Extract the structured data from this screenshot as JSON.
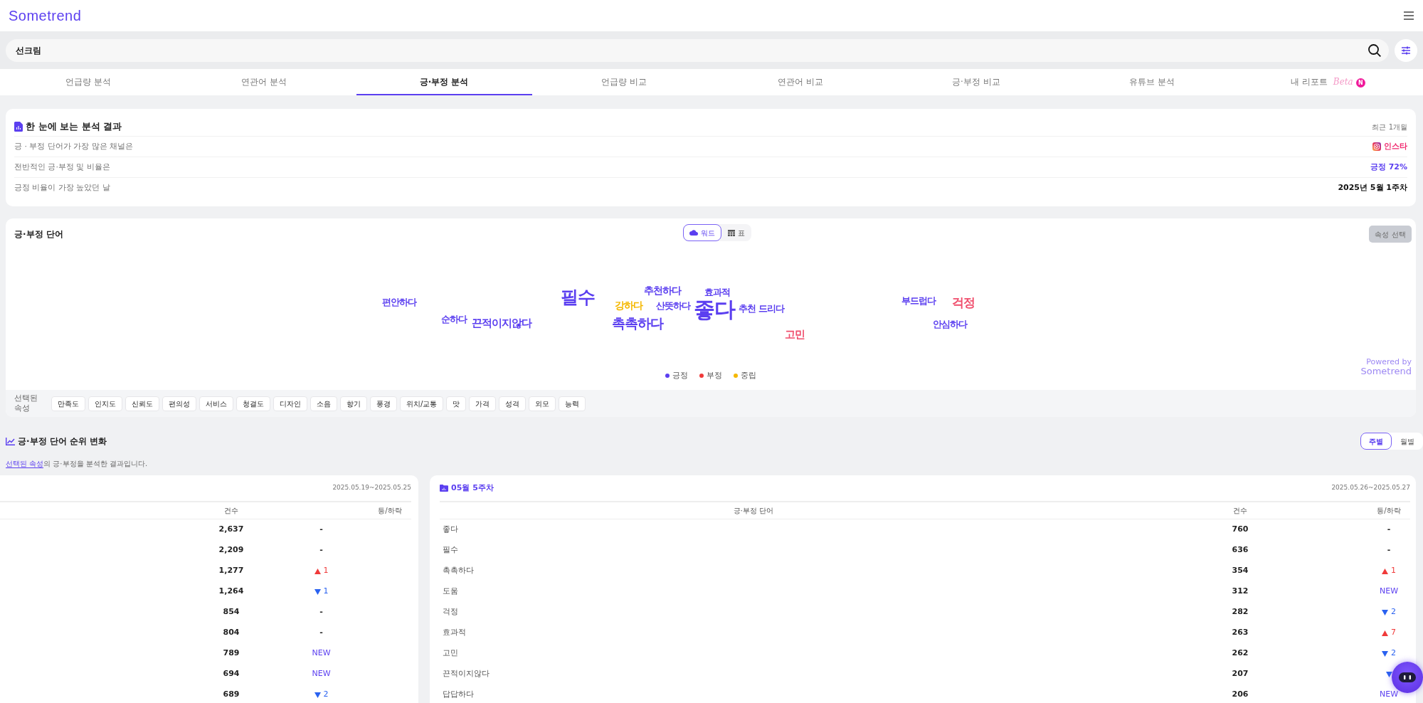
{
  "header": {
    "logo": "Sometrend"
  },
  "search": {
    "value": "선크림"
  },
  "tabs": [
    {
      "label": "언급량 분석",
      "selected": false
    },
    {
      "label": "연관어 분석",
      "selected": false
    },
    {
      "label": "긍·부정 분석",
      "selected": true
    },
    {
      "label": "언급량 비교",
      "selected": false
    },
    {
      "label": "연관어 비교",
      "selected": false
    },
    {
      "label": "긍·부정 비교",
      "selected": false
    },
    {
      "label": "유튜브 분석",
      "selected": false
    },
    {
      "label": "내 리포트",
      "selected": false,
      "beta": "Beta",
      "badge": "N"
    }
  ],
  "summary": {
    "title": "한 눈에 보는 분석 결과",
    "period": "최근 1개월",
    "rows": [
      {
        "label": "긍 · 부정 단어가 가장 많은 채널은",
        "value": "인스타",
        "kind": "channel"
      },
      {
        "label": "전반적인 긍·부정 및 비율은",
        "value": "긍정 72%",
        "kind": "ratio"
      },
      {
        "label": "긍정 비율이 가장 높았던 날",
        "value": "2025년 5월 1주차",
        "kind": "date"
      }
    ]
  },
  "word_panel": {
    "title": "긍·부정 단어",
    "views": [
      {
        "label": "워드",
        "kind": "cloud",
        "selected": true
      },
      {
        "label": "표",
        "kind": "table",
        "selected": false
      }
    ],
    "attribute_button": "속성 선택",
    "words": [
      {
        "text": "편안하다",
        "color": "#5b3ff0"
      },
      {
        "text": "순하다",
        "color": "#5b3ff0"
      },
      {
        "text": "끈적이지않다",
        "color": "#5b3ff0"
      },
      {
        "text": "필수",
        "color": "#5b3ff0"
      },
      {
        "text": "강하다",
        "color": "#f5b800"
      },
      {
        "text": "추천하다",
        "color": "#5b3ff0"
      },
      {
        "text": "산뜻하다",
        "color": "#5b3ff0"
      },
      {
        "text": "촉촉하다",
        "color": "#5b3ff0"
      },
      {
        "text": "효과적",
        "color": "#5b3ff0"
      },
      {
        "text": "좋다",
        "color": "#5b3ff0"
      },
      {
        "text": "추천 드리다",
        "color": "#5b3ff0"
      },
      {
        "text": "고민",
        "color": "#f0506e"
      },
      {
        "text": "부드럽다",
        "color": "#5b3ff0"
      },
      {
        "text": "걱정",
        "color": "#f0506e"
      },
      {
        "text": "안심하다",
        "color": "#5b3ff0"
      }
    ],
    "legend": [
      {
        "label": "긍정",
        "color": "#5b3ff0"
      },
      {
        "label": "부정",
        "color": "#f03a3a"
      },
      {
        "label": "중립",
        "color": "#f5b800"
      }
    ],
    "powered_by": "Powered by",
    "powered_brand": "Sometrend",
    "attributes_label": "선택된 속성",
    "attributes": [
      "만족도",
      "인지도",
      "신뢰도",
      "편의성",
      "서비스",
      "청결도",
      "디자인",
      "소음",
      "향기",
      "풍경",
      "위치/교통",
      "맛",
      "가격",
      "성격",
      "외모",
      "능력"
    ]
  },
  "ranking": {
    "title": "긍·부정 단어 순위 변화",
    "note_link": "선택된 속성",
    "note_text": "의 긍·부정을 분석한 결과입니다.",
    "periods": [
      {
        "label": "주별",
        "selected": true
      },
      {
        "label": "월별",
        "selected": false
      }
    ],
    "tables": [
      {
        "date_range": "2025.05.19~2025.05.25",
        "columns": [
          "건수",
          "등/하락"
        ],
        "rows": [
          {
            "count": "2,637",
            "change": {
              "kind": "same",
              "value": "-"
            }
          },
          {
            "count": "2,209",
            "change": {
              "kind": "same",
              "value": "-"
            }
          },
          {
            "count": "1,277",
            "change": {
              "kind": "up",
              "value": "1"
            }
          },
          {
            "count": "1,264",
            "change": {
              "kind": "down",
              "value": "1"
            }
          },
          {
            "count": "854",
            "change": {
              "kind": "same",
              "value": "-"
            }
          },
          {
            "count": "804",
            "change": {
              "kind": "same",
              "value": "-"
            }
          },
          {
            "count": "789",
            "change": {
              "kind": "new",
              "value": "NEW"
            }
          },
          {
            "count": "694",
            "change": {
              "kind": "new",
              "value": "NEW"
            }
          },
          {
            "count": "689",
            "change": {
              "kind": "down",
              "value": "2"
            }
          }
        ]
      },
      {
        "title": "05월 5주차",
        "date_range": "2025.05.26~2025.05.27",
        "columns": [
          "긍·부정 단어",
          "건수",
          "등/하락"
        ],
        "rows": [
          {
            "word": "좋다",
            "count": "760",
            "change": {
              "kind": "same",
              "value": "-"
            }
          },
          {
            "word": "필수",
            "count": "636",
            "change": {
              "kind": "same",
              "value": "-"
            }
          },
          {
            "word": "촉촉하다",
            "count": "354",
            "change": {
              "kind": "up",
              "value": "1"
            }
          },
          {
            "word": "도움",
            "count": "312",
            "change": {
              "kind": "new",
              "value": "NEW"
            }
          },
          {
            "word": "걱정",
            "count": "282",
            "change": {
              "kind": "down",
              "value": "2"
            }
          },
          {
            "word": "효과적",
            "count": "263",
            "change": {
              "kind": "up",
              "value": "7"
            }
          },
          {
            "word": "고민",
            "count": "262",
            "change": {
              "kind": "down",
              "value": "2"
            }
          },
          {
            "word": "끈적이지않다",
            "count": "207",
            "change": {
              "kind": "down"
            }
          },
          {
            "word": "답답하다",
            "count": "206",
            "change": {
              "kind": "new",
              "value": "NEW"
            }
          }
        ]
      }
    ]
  }
}
